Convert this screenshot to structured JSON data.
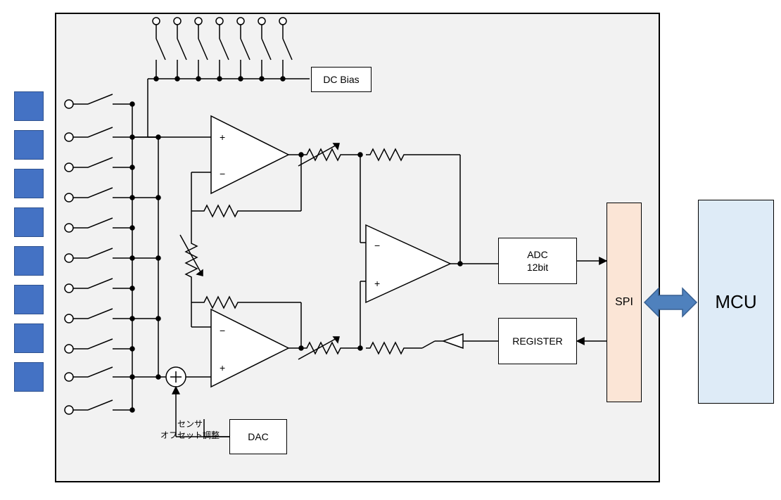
{
  "blocks": {
    "dc_bias": "DC Bias",
    "adc": "ADC\n12bit",
    "register": "REGISTER",
    "dac": "DAC",
    "spi": "SPI",
    "mcu": "MCU"
  },
  "labels": {
    "offset_adj": "センサ\nオフセット調整"
  },
  "colors": {
    "chip_bg": "#f2f2f2",
    "sensor_fill": "#4472c4",
    "spi_fill": "#fbe5d6",
    "mcu_fill": "#deebf7",
    "arrow_fill": "#4f81bd"
  },
  "schematic": {
    "sensor_pads": 8,
    "input_switch_rows": 11,
    "top_switches": 7,
    "op_amps": 3,
    "variable_resistors": 3,
    "fixed_resistors": 4,
    "summing_node": true,
    "buffer_triangle": true
  }
}
